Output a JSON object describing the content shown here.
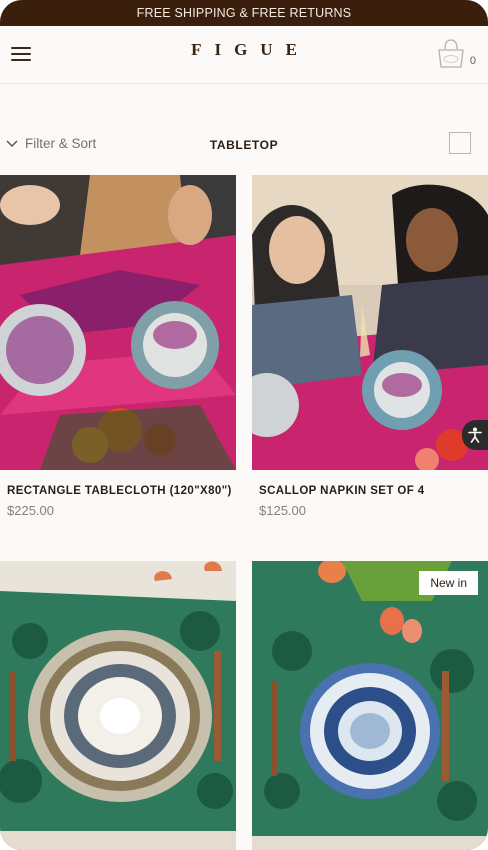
{
  "announcement": "FREE SHIPPING & FREE RETURNS",
  "header": {
    "menu_icon": "hamburger-icon",
    "logo": "FIGUE",
    "cart_icon": "shopping-bag-icon",
    "cart_count": "0"
  },
  "toolbar": {
    "filter_label": "Filter & Sort",
    "filter_icon": "chevron-down-icon",
    "collection_title": "TABLETOP",
    "view_icons": [
      "grid-view-icon",
      "single-view-icon"
    ]
  },
  "products": [
    {
      "name": "RECTANGLE TABLECLOTH (120\"X80\")",
      "price": "$225.00"
    },
    {
      "name": "SCALLOP NAPKIN SET OF 4",
      "price": "$125.00"
    },
    {
      "name": "",
      "price": ""
    },
    {
      "name": "",
      "price": "",
      "badge": "New in"
    }
  ],
  "colors": {
    "announcement_bg": "#3a1f0c",
    "accent_pink": "#d1246a",
    "accent_green": "#1d6a4e"
  }
}
